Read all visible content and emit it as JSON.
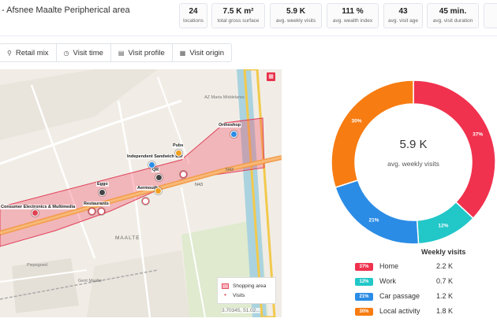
{
  "header": {
    "title": "- Afsnee Maalte Peripherical area",
    "stats": [
      {
        "value": "24",
        "label": "locations"
      },
      {
        "value": "7.5 K m²",
        "label": "total gross surface"
      },
      {
        "value": "5.9 K",
        "label": "avg. weekly visits"
      },
      {
        "value": "111 %",
        "label": "avg. wealth index"
      },
      {
        "value": "43",
        "label": "avg. visit age"
      },
      {
        "value": "45 min.",
        "label": "avg. visit duration"
      }
    ]
  },
  "tabs": [
    {
      "label": "Retail mix",
      "icon": "map-marker-icon"
    },
    {
      "label": "Visit time",
      "icon": "clock-icon"
    },
    {
      "label": "Visit profile",
      "icon": "bar-chart-icon"
    },
    {
      "label": "Visit origin",
      "icon": "map-icon"
    }
  ],
  "map": {
    "street_labels": [
      "AZ Maria Middelares",
      "N43",
      "N43",
      "MAALTE",
      "Gent Maalte",
      "Piepsgoed"
    ],
    "poi_labels": [
      "Orthoshop",
      "Pubs",
      "Independent Sandwich Bar",
      "QR",
      "Eggo",
      "Aermouth",
      "Consumer Electronics & Multimedia",
      "Restaurants"
    ],
    "legend": {
      "area": "Shopping area",
      "visits": "Visits"
    },
    "coords": "3.70345, 51.02..."
  },
  "chart_data": {
    "type": "pie",
    "categories": [
      "Home",
      "Work",
      "Car passage",
      "Local activity"
    ],
    "values": [
      37,
      12,
      21,
      30
    ],
    "center_value": "5.9 K",
    "center_label": "avg. weekly visits",
    "colors": [
      "#f0324e",
      "#22c7c8",
      "#2b8ce6",
      "#f77c12"
    ]
  },
  "weekly_visits": {
    "title": "Weekly visits",
    "rows": [
      {
        "pct": "37%",
        "label": "Home",
        "value": "2.2 K",
        "color": "#f0324e"
      },
      {
        "pct": "12%",
        "label": "Work",
        "value": "0.7 K",
        "color": "#22c7c8"
      },
      {
        "pct": "21%",
        "label": "Car passage",
        "value": "1.2 K",
        "color": "#2b8ce6"
      },
      {
        "pct": "30%",
        "label": "Local activity",
        "value": "1.8 K",
        "color": "#f77c12"
      }
    ]
  }
}
